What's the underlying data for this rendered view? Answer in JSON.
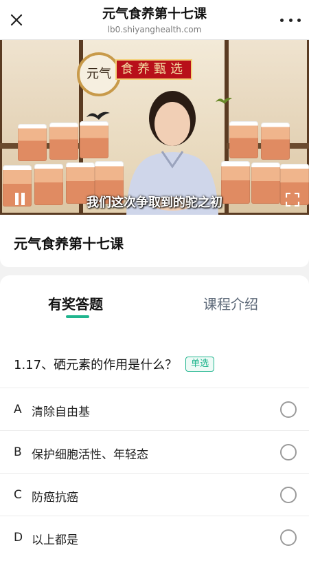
{
  "nav": {
    "title": "元气食养第十七课",
    "url": "lb0.shiyanghealth.com",
    "close_icon": "close-icon",
    "more_icon": "more-icon"
  },
  "video": {
    "banner_text": "食养甄选",
    "logo_text": "元气",
    "subtitle": "我们这次争取到的驼之初",
    "state": "playing",
    "pause_icon": "pause-icon",
    "fullscreen_icon": "fullscreen-icon"
  },
  "course": {
    "title": "元气食养第十七课"
  },
  "tabs": [
    {
      "label": "有奖答题",
      "active": true
    },
    {
      "label": "课程介绍",
      "active": false
    }
  ],
  "quiz": {
    "question": "1.17、硒元素的作用是什么？",
    "type_badge": "单选",
    "options": [
      {
        "letter": "A",
        "text": "清除自由基",
        "selected": false
      },
      {
        "letter": "B",
        "text": "保护细胞活性、年轻态",
        "selected": false
      },
      {
        "letter": "C",
        "text": "防癌抗癌",
        "selected": false
      },
      {
        "letter": "D",
        "text": "以上都是",
        "selected": false
      }
    ]
  },
  "colors": {
    "accent": "#20b58e",
    "tab_inactive": "#5f6b7a",
    "banner_red": "#b8101a"
  }
}
